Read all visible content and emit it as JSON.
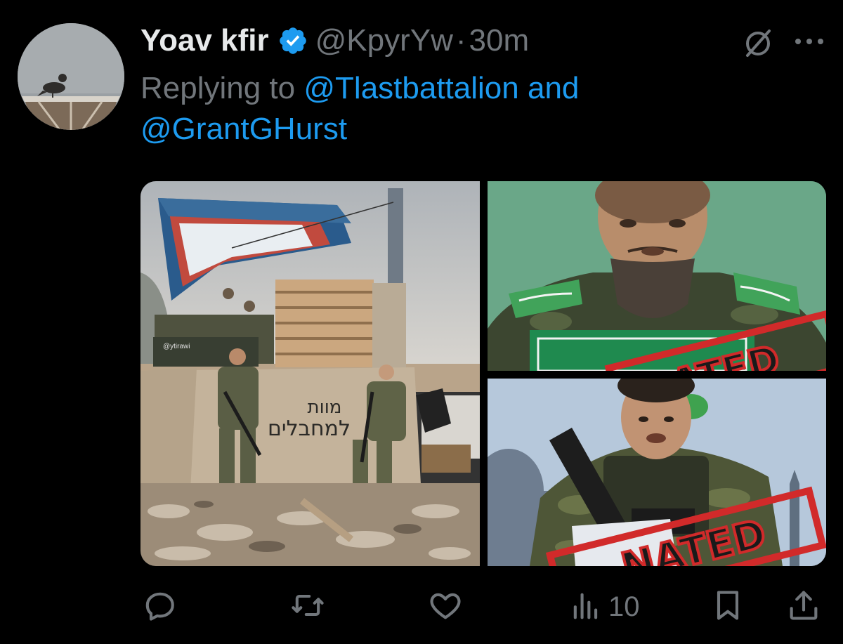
{
  "tweet": {
    "author_name": "Yoav kfir",
    "handle": "@KpyrYw",
    "separator": "·",
    "time": "30m",
    "reply_prefix": "Replying to",
    "reply_mention_1": "@Tlastbattalion",
    "reply_and": "and",
    "reply_mention_2": "@GrantGHurst"
  },
  "media": {
    "main_photo": {
      "graffiti_line_1": "מוות",
      "graffiti_line_2": "למחבלים",
      "watermark": "@ytirawi"
    },
    "top_right_stamp": "ATED",
    "bottom_right_stamp": "NATED"
  },
  "actions": {
    "views_count": "10"
  },
  "icons": [
    "verified-badge-icon",
    "mute-icon",
    "more-icon",
    "reply-icon",
    "retweet-icon",
    "like-icon",
    "views-icon",
    "bookmark-icon",
    "share-icon"
  ],
  "colors": {
    "background": "#000000",
    "primary_text": "#e7e9ea",
    "secondary_text": "#71767b",
    "accent": "#1d9bf0"
  }
}
